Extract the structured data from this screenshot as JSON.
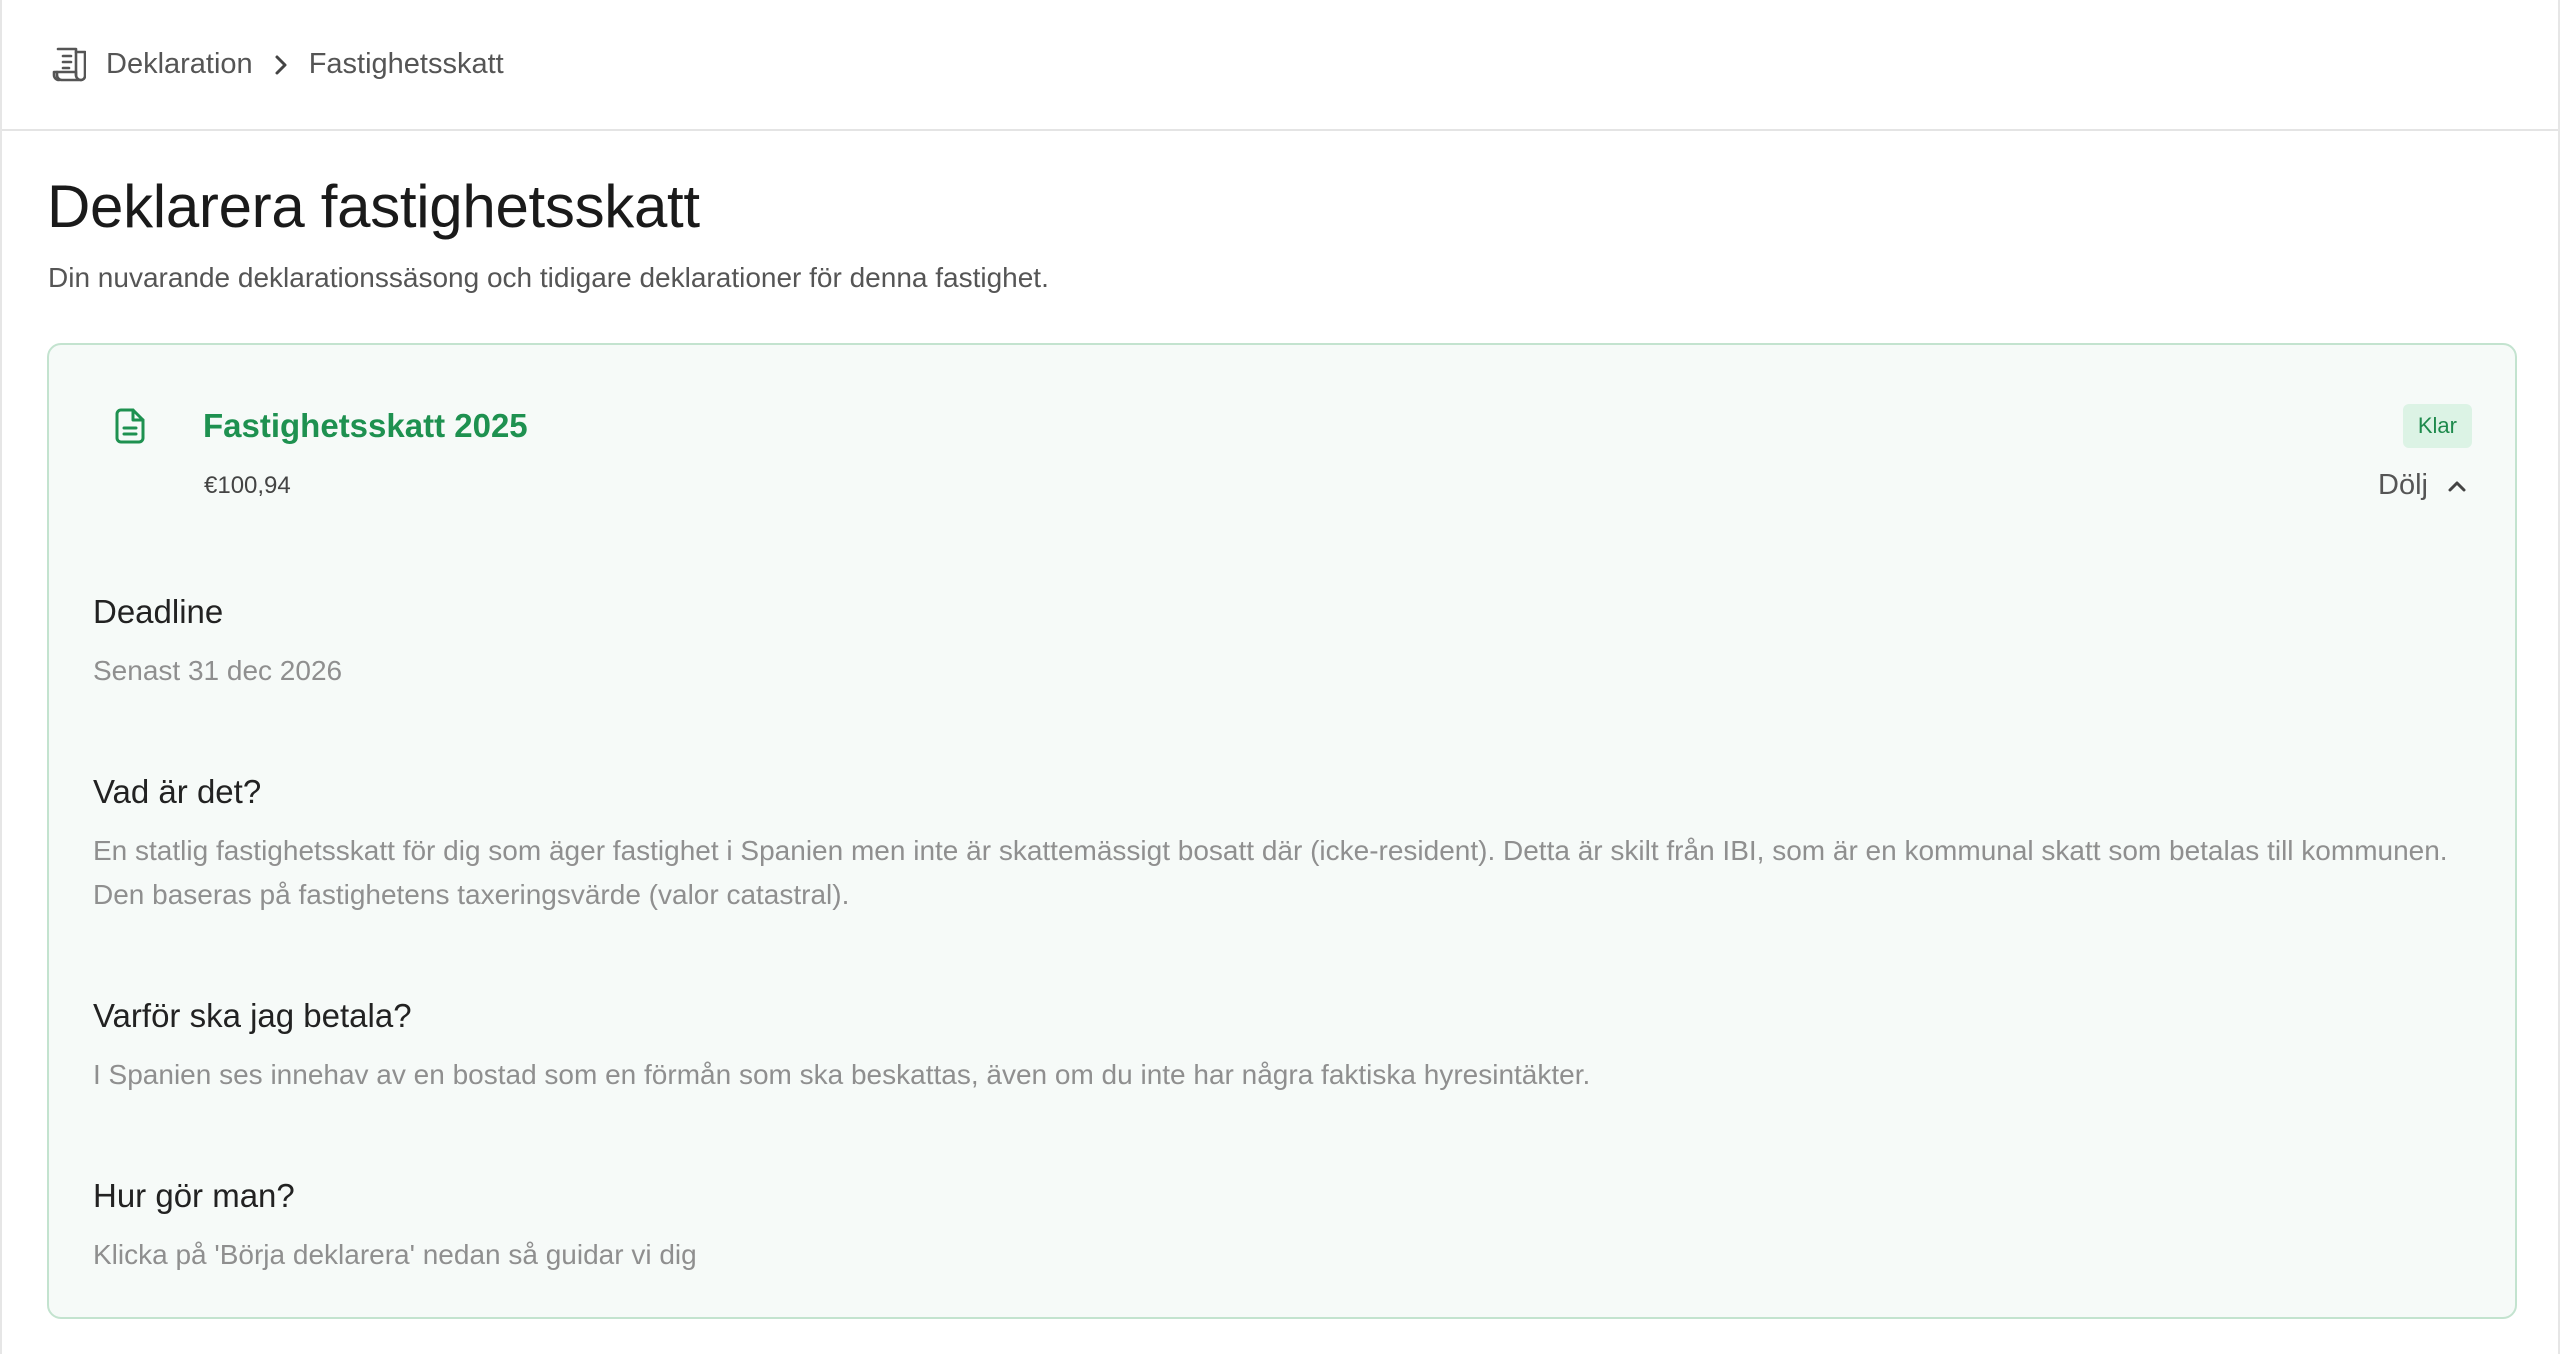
{
  "breadcrumb": {
    "icon": "receipt-icon",
    "root": "Deklaration",
    "separator_icon": "chevron-right-icon",
    "current": "Fastighetsskatt"
  },
  "page": {
    "title": "Deklarera fastighetsskatt",
    "subtitle": "Din nuvarande deklarationssäsong och tidigare deklarationer för denna fastighet."
  },
  "card": {
    "icon": "document-icon",
    "title": "Fastighetsskatt 2025",
    "amount": "€100,94",
    "status": "Klar",
    "toggle_label": "Dölj",
    "toggle_icon": "chevron-up-icon",
    "sections": [
      {
        "heading": "Deadline",
        "body": "Senast 31 dec 2026"
      },
      {
        "heading": "Vad är det?",
        "body": "En statlig fastighetsskatt för dig som äger fastighet i Spanien men inte är skattemässigt bosatt där (icke-resident). Detta är skilt från IBI, som är en kommunal skatt som betalas till kommunen. Den baseras på fastighetens taxeringsvärde (valor catastral)."
      },
      {
        "heading": "Varför ska jag betala?",
        "body": "I Spanien ses innehav av en bostad som en förmån som ska beskattas, även om du inte har några faktiska hyresintäkter."
      },
      {
        "heading": "Hur gör man?",
        "body": "Klicka på 'Börja deklarera' nedan så guidar vi dig"
      }
    ]
  },
  "colors": {
    "accent_green": "#1e9150",
    "card_bg": "#f6faf8",
    "card_border": "#c3e3cf",
    "badge_bg": "#dcf3e5"
  }
}
